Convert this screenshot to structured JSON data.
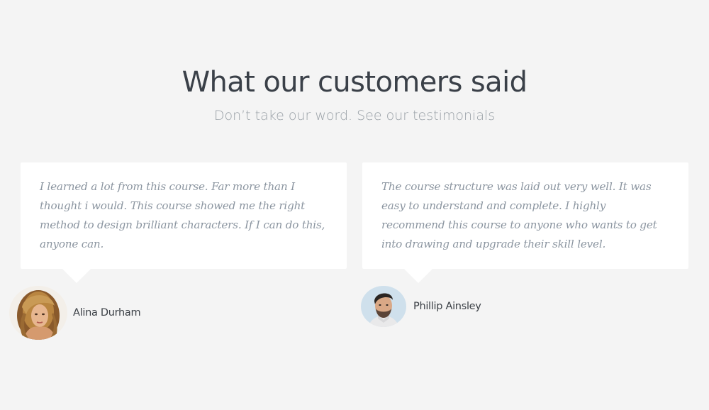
{
  "section": {
    "title": "What our customers said",
    "subtitle": "Don’t take our word. See our testimonials"
  },
  "testimonials": [
    {
      "quote": "I learned a lot from this course. Far more than I thought i would. This course showed me the right method to design brilliant characters. If I can do this, anyone can.",
      "author": "Alina Durham",
      "avatar_icon": "woman-portrait-avatar"
    },
    {
      "quote": "The course structure was laid out very well. It was easy to understand and complete. I highly recommend this course to anyone who wants to get into drawing and upgrade their skill level.",
      "author": "Phillip  Ainsley",
      "avatar_icon": "man-portrait-avatar"
    }
  ],
  "colors": {
    "background": "#f4f4f4",
    "card": "#ffffff",
    "heading": "#3a4048",
    "subtitle": "#9aa1a7",
    "quote": "#8b95a0"
  }
}
